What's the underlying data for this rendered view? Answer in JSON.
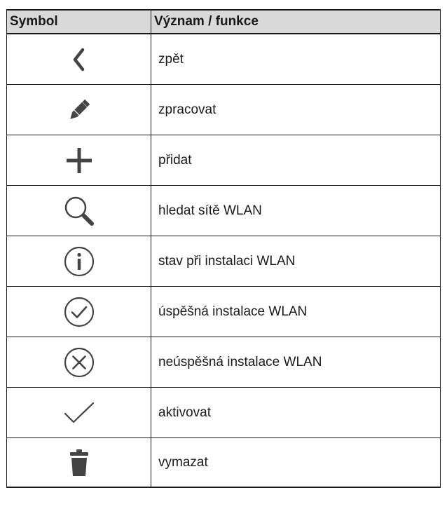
{
  "table": {
    "headers": {
      "symbol": "Symbol",
      "meaning": "Význam / funkce"
    },
    "rows": [
      {
        "icon": "back-chevron-icon",
        "label": "zpět"
      },
      {
        "icon": "pencil-icon",
        "label": "zpracovat"
      },
      {
        "icon": "plus-icon",
        "label": "přidat"
      },
      {
        "icon": "search-icon",
        "label": "hledat sítě WLAN"
      },
      {
        "icon": "info-circle-icon",
        "label": "stav při instalaci WLAN"
      },
      {
        "icon": "check-circle-icon",
        "label": "úspěšná instalace WLAN"
      },
      {
        "icon": "x-circle-icon",
        "label": "neúspěšná instalace WLAN"
      },
      {
        "icon": "checkmark-icon",
        "label": "aktivovat"
      },
      {
        "icon": "trash-icon",
        "label": "vymazat"
      }
    ]
  },
  "colors": {
    "header_background": "#d9d9d9",
    "border": "#1a1a1a",
    "icon": "#444444"
  }
}
